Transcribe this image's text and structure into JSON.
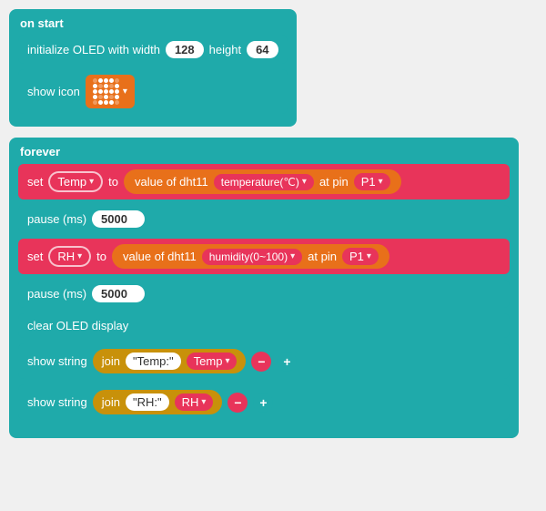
{
  "on_start": {
    "label": "on start",
    "init_block": {
      "text1": "initialize OLED with width",
      "width_value": "128",
      "height_label": "height",
      "height_value": "64"
    },
    "show_icon": {
      "text": "show icon"
    }
  },
  "forever": {
    "label": "forever",
    "set_temp": {
      "set_label": "set",
      "var_name": "Temp",
      "to_label": "to",
      "dht_text": "value of dht11",
      "sensor_label": "temperature(℃)",
      "at_pin": "at pin",
      "pin_value": "P1"
    },
    "pause1": {
      "text": "pause (ms)",
      "value": "5000"
    },
    "set_rh": {
      "set_label": "set",
      "var_name": "RH",
      "to_label": "to",
      "dht_text": "value of dht11",
      "sensor_label": "humidity(0~100)",
      "at_pin": "at pin",
      "pin_value": "P1"
    },
    "pause2": {
      "text": "pause (ms)",
      "value": "5000"
    },
    "clear": {
      "text": "clear OLED display"
    },
    "show_string1": {
      "text": "show string",
      "join_label": "join",
      "string_val": "\"Temp:\"",
      "var_name": "Temp"
    },
    "show_string2": {
      "text": "show string",
      "join_label": "join",
      "string_val": "\"RH:\"",
      "var_name": "RH"
    }
  },
  "icons": {
    "dropdown_arrow": "▾",
    "minus": "−",
    "plus": "+"
  }
}
